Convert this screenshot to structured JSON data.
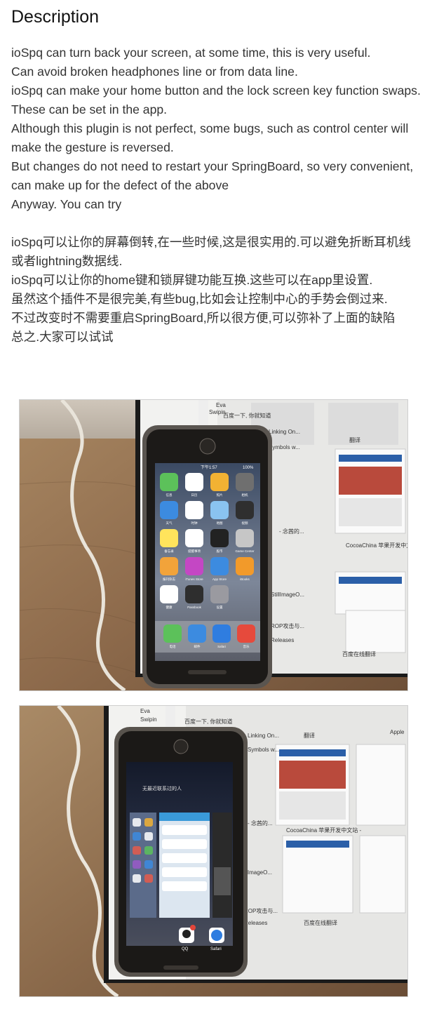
{
  "page": {
    "title": "Description"
  },
  "description_en": [
    "ioSpq can turn back your screen, at some time, this is very useful.",
    "Can avoid broken headphones line or from data line.",
    "ioSpq can make your home button and the lock screen key function swaps. These can be set in the app.",
    "Although this plugin is not perfect, some bugs, such as control center will make the gesture is reversed.",
    "But changes do not need to restart your SpringBoard, so very convenient, can make up for the defect of the above",
    "Anyway. You can try"
  ],
  "description_zh": [
    "ioSpq可以让你的屏幕倒转,在一些时候,这是很实用的.可以避免折断耳机线或者lightning数据线.",
    "ioSpq可以让你的home键和锁屏键功能互换.这些可以在app里设置.",
    "虽然这个插件不是很完美,有些bug,比如会让控制中心的手势会倒过来.",
    "不过改变时不需要重启SpringBoard,所以很方便,可以弥补了上面的缺陷",
    "总之.大家可以试试"
  ],
  "screenshot1": {
    "status_carrier": "",
    "status_time": "下午1:57",
    "status_battery": "100%",
    "apps": [
      "信息",
      "日历",
      "照片",
      "相机",
      "天气",
      "时钟",
      "地图",
      "视频",
      "备忘录",
      "提醒事项",
      "股市",
      "Game Center",
      "报刊杂志",
      "iTunes Store",
      "App Store",
      "iBooks",
      "健康",
      "Passbook",
      "设置"
    ],
    "dock": [
      "电话",
      "邮件",
      "Safari",
      "音乐"
    ],
    "bg_texts": [
      "Eva",
      "Swipin",
      "翻译",
      "百度一下, 你就知道",
      "Linking On...",
      "Symbols w...",
      "- 念茜的...",
      "CocoaChina 苹果开发中文站 -",
      "StillImageO...",
      "ROP攻击与...",
      "Releases",
      "百度在线翻译"
    ]
  },
  "screenshot2": {
    "switcher_title": "无最近联系过的人",
    "cards": [
      "QQ",
      "Safari"
    ],
    "bg_texts": [
      "Eva",
      "Swipin",
      "翻译",
      "百度一下, 你就知道",
      "Linking On...",
      "Symbols w...",
      "- 念茜的...",
      "CocoaChina 苹果开发中文站 -",
      "StillImageO...",
      "ROP攻击与...",
      "Releases",
      "百度在线翻译",
      "Apple"
    ]
  },
  "colors": {
    "text": "#333333",
    "title": "#111111",
    "wood": "#8b6b4f",
    "wall": "#c7bfb4",
    "phone_frame": "#5a5550"
  }
}
